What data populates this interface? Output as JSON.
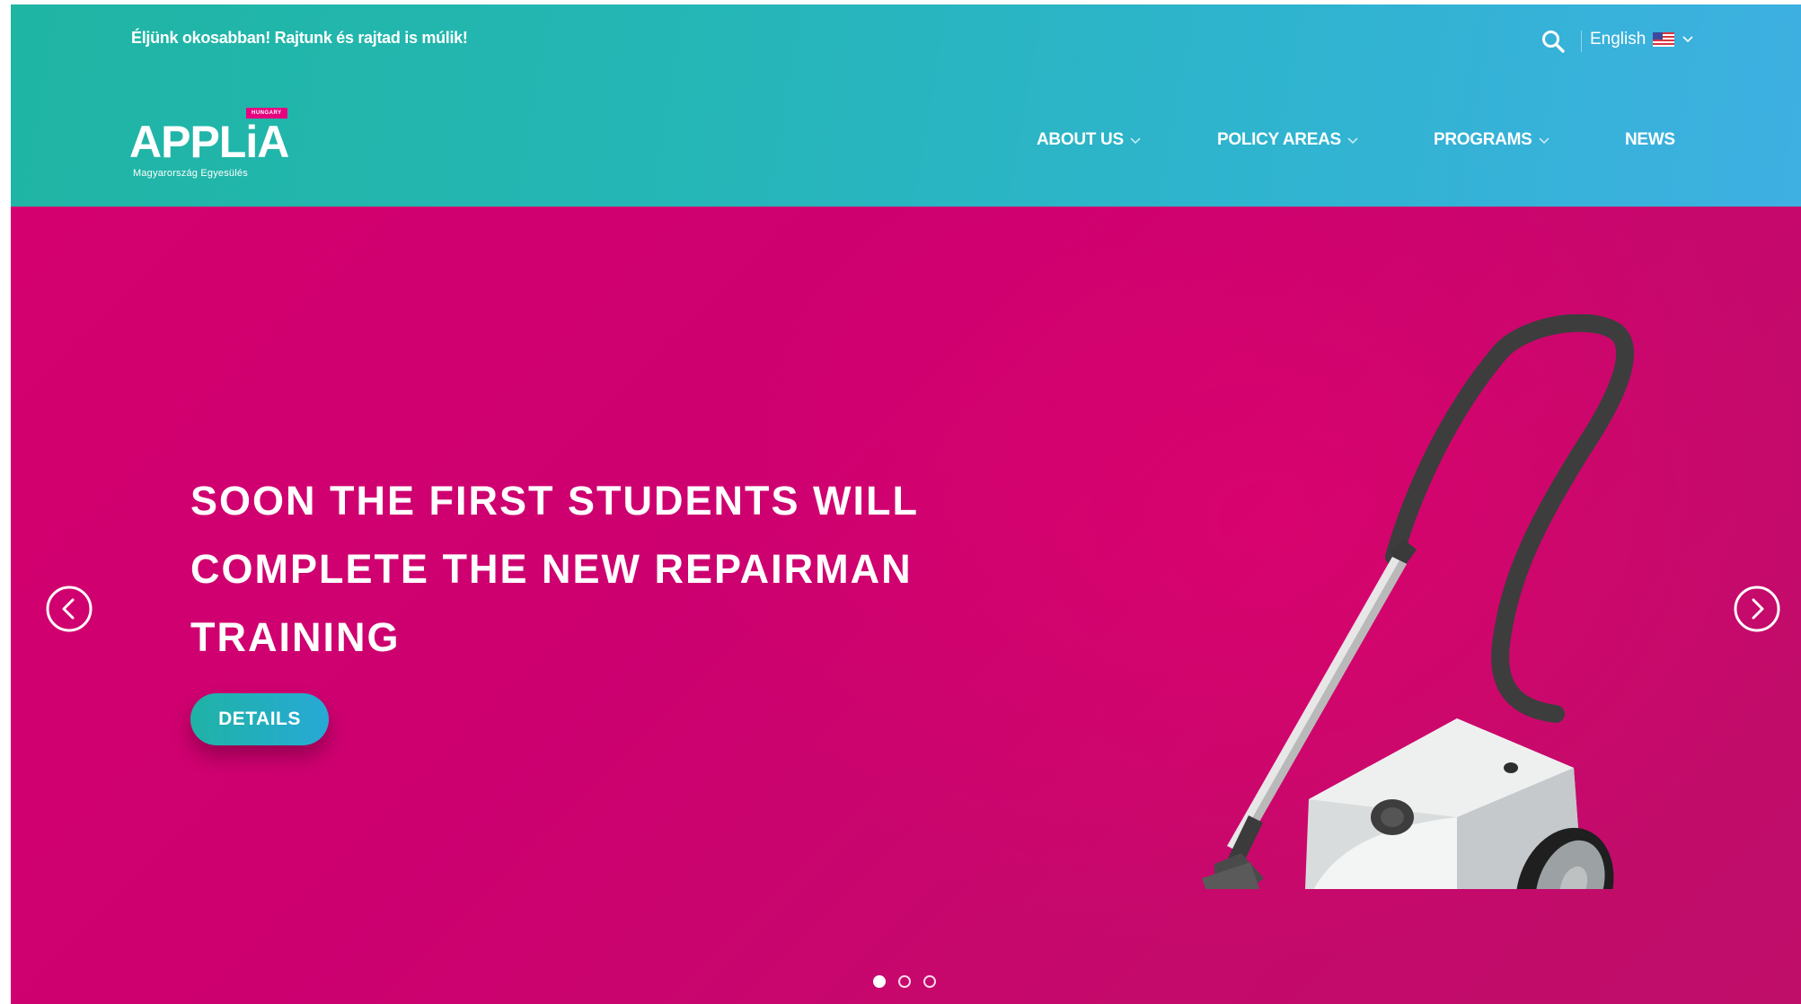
{
  "topbar": {
    "tagline": "Éljünk okosabban! Rajtunk és rajtad is múlik!",
    "language_label": "English",
    "language_flag_icon": "us-flag-icon",
    "search_icon": "search-icon"
  },
  "logo": {
    "badge": "HUNGARY",
    "wordmark": "APPLiA",
    "subtitle": "Magyarország Egyesülés"
  },
  "nav": {
    "items": [
      {
        "label": "ABOUT US",
        "has_dropdown": true
      },
      {
        "label": "POLICY AREAS",
        "has_dropdown": true
      },
      {
        "label": "PROGRAMS",
        "has_dropdown": true
      },
      {
        "label": "NEWS",
        "has_dropdown": false
      }
    ]
  },
  "hero": {
    "title_lines": [
      "SOON THE FIRST STUDENTS WILL",
      "COMPLETE THE NEW REPAIRMAN",
      "TRAINING"
    ],
    "button_label": "DETAILS",
    "image": "vacuum-cleaner-illustration",
    "slides_total": 3,
    "active_slide": 1
  },
  "colors": {
    "header_gradient_start": "#1fb5a3",
    "header_gradient_end": "#3eb0e2",
    "hero_background": "#d0006f",
    "brand_pink": "#e6007e"
  }
}
